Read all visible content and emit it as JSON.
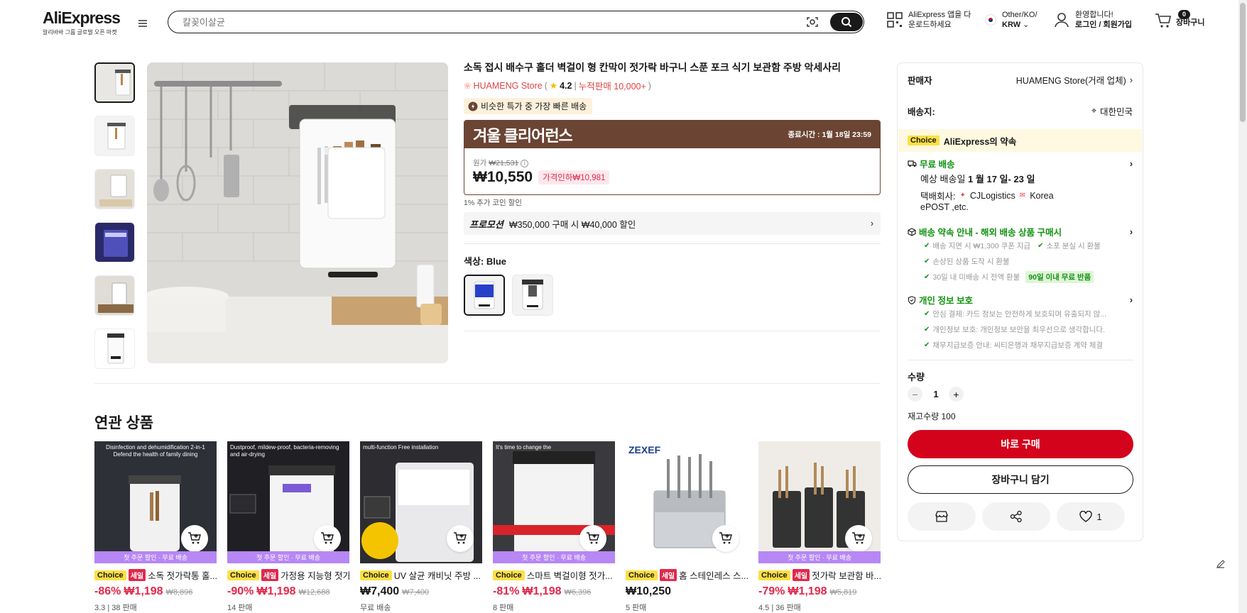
{
  "header": {
    "logo": "AliExpress",
    "logo_sub": "알리바바 그룹 글로벌 오픈 마켓",
    "search_placeholder": "칼꽂이살균",
    "app_download": "AliExpress 앱을 다운로드하세요",
    "region_line1": "Other/KO/",
    "region_line2": "KRW",
    "welcome": "환영합니다!",
    "login": "로그인 / 회원가입",
    "cart_count": "0",
    "cart_label": "장바구니"
  },
  "product": {
    "title": "소독 접시 배수구 홀더 벽걸이 형 칸막이 젓가락 바구니 스푼 포크 식기 보관함 주방 악세사리",
    "store": "HUAMENG Store",
    "rating": "4.2",
    "sold": "누적판매 10,000+",
    "fast_tag": "비슷한 특가 중 가장 빠른 배송",
    "deal_title": "겨울 클리어런스",
    "deal_end_label": "종료시간 :",
    "deal_end": "1월 18일 23:59",
    "orig_label": "원가",
    "orig_price": "₩21,531",
    "price": "₩10,550",
    "price_drop": "가격인하₩10,981",
    "coin": "1% 추가 코인 할인",
    "promo_label": "프로모션",
    "promo_text": "₩350,000 구매 시 ₩40,000 할인",
    "color_label": "색상: Blue",
    "thumbnails": 6,
    "selected_color": "Blue"
  },
  "sidebar": {
    "seller_label": "판매자",
    "seller": "HUAMENG Store(거래 업체)",
    "ship_label": "배송지:",
    "ship_to": "대한민국",
    "choice": "Choice",
    "promise": "AliExpress의 약속",
    "free_ship": "무료 배송",
    "est_label": "예상 배송일",
    "est_date": "1 월 17 일- 23 일",
    "carrier_label": "택배회사:",
    "carrier1": "CJLogistics",
    "carrier2": "Korea",
    "carrier3": "ePOST ,etc.",
    "promise_title": "배송 약속 안내 - 해외 배송 상품 구매시",
    "p1": "배송 지연 시 ₩1,300 쿠폰 지급",
    "p2": "소포 분실 시 환불",
    "p3": "손상된 상품 도착 시 환불",
    "p4": "30일 내 미배송 시 전액 환불",
    "p4_badge": "90일 이내 무료 반품",
    "privacy_title": "개인 정보 보호",
    "pr1": "안심 결제: 카드 정보는 안전하게 보호되며 유출되지 않...",
    "pr2": "개인정보 보호: 개인정보 보안을 최우선으로 생각합니다.",
    "pr3": "채무지급보증 안내: 씨티은행과 채무지급보증 계약 체결",
    "qty_label": "수량",
    "qty": "1",
    "stock": "재고수량 100",
    "buy": "바로 구매",
    "add_cart": "장바구니 담기",
    "wish_count": "1"
  },
  "related": {
    "title": "연관 상품",
    "ribbon": "첫 주문 할인 · 무료 배송",
    "items": [
      {
        "choice": "Choice",
        "sale": "세일",
        "name": "소독 젓가락통 홀...",
        "pct": "-86%",
        "price": "₩1,198",
        "orig": "₩8,896",
        "meta": "3.3 | 38 판매",
        "img_text": "Disinfection and dehumidification 2-in-1 Defend the health of family dining"
      },
      {
        "choice": "Choice",
        "sale": "세일",
        "name": "가정용 지능형 젓가락 ...",
        "pct": "-90%",
        "price": "₩1,198",
        "orig": "₩12,688",
        "meta": "14 판매",
        "img_text": "Dustproof, mildew-proof, bacteria-removing and air-drying"
      },
      {
        "choice": "Choice",
        "sale": "",
        "name": "UV 살균 캐비닛 주방 ...",
        "pct": "",
        "price": "₩7,400",
        "orig": "₩7,400",
        "meta": "무료 배송",
        "img_text": "multi-function Free installation"
      },
      {
        "choice": "Choice",
        "sale": "",
        "name": "스마트 벽걸이형 젓가...",
        "pct": "-81%",
        "price": "₩1,198",
        "orig": "₩6,396",
        "meta": "8 판매",
        "img_text": "It's time to change the"
      },
      {
        "choice": "Choice",
        "sale": "세일",
        "name": "홈 스테인레스 스...",
        "pct": "",
        "price": "₩10,250",
        "orig": "",
        "meta": "5 판매",
        "img_text": "ZEXEF"
      },
      {
        "choice": "Choice",
        "sale": "세일",
        "name": "젓가락 보관함 바...",
        "pct": "-79%",
        "price": "₩1,198",
        "orig": "₩5,819",
        "meta": "4.5 | 36 판매",
        "img_text": ""
      }
    ]
  },
  "colors": {
    "accent": "#d3031c",
    "deal": "#6b4433",
    "choice": "#fde042",
    "green": "#10920f"
  }
}
